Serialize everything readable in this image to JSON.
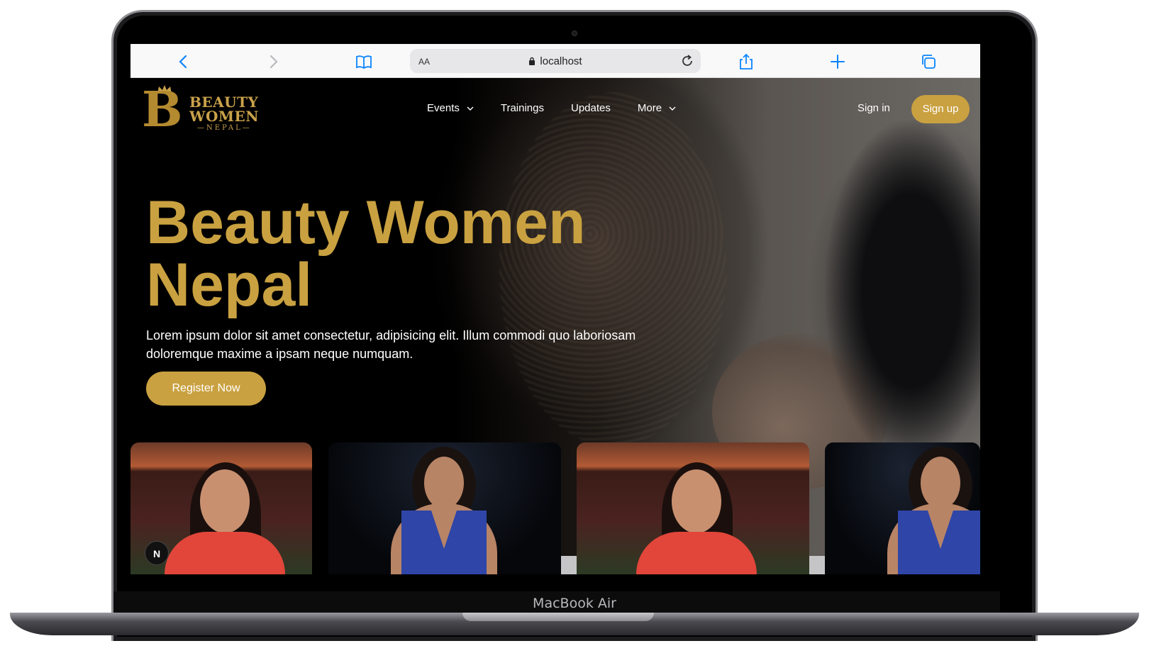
{
  "device": {
    "label": "MacBook Air"
  },
  "browser": {
    "url_display": "localhost",
    "text_size_label": "AA",
    "icons": [
      "chevron-left-icon",
      "chevron-right-icon",
      "book-icon",
      "lock-icon",
      "reload-icon",
      "share-icon",
      "plus-icon",
      "tabs-icon"
    ],
    "accent_color": "#0a84ff"
  },
  "site": {
    "logo": {
      "line1": "BEAUTY",
      "line2": "WOMEN",
      "line3": "—NEPAL—",
      "initial": "B"
    },
    "nav": [
      {
        "label": "Events",
        "has_dropdown": true
      },
      {
        "label": "Trainings",
        "has_dropdown": false
      },
      {
        "label": "Updates",
        "has_dropdown": false
      },
      {
        "label": "More",
        "has_dropdown": true
      }
    ],
    "sign_in": "Sign in",
    "sign_up": "Sign up",
    "brand_color": "#c9a140"
  },
  "hero": {
    "title_line1": "Beauty Women",
    "title_line2": "Nepal",
    "description": "Lorem ipsum dolor sit amet consectetur, adipisicing elit. Illum commodi quo laboriosam doloremque maxime a ipsam neque numquam.",
    "cta": "Register Now"
  },
  "dev_badge": "N"
}
